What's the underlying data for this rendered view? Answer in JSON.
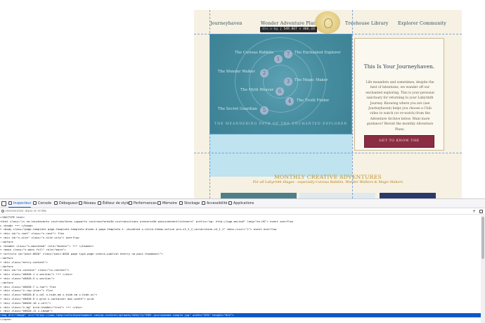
{
  "site": {
    "nav": [
      "Journeyhaven",
      "Wonder Adventure Plans",
      "Treehouse Library",
      "Explorer Community"
    ],
    "map_nodes": [
      {
        "num": "1",
        "label": "The Curious Rabbits"
      },
      {
        "num": "7",
        "label": "The Enchanted Explorer"
      },
      {
        "num": "2",
        "label": "The Wonder Walker"
      },
      {
        "num": "3",
        "label": "The Magic Maker"
      },
      {
        "num": "6",
        "label": "The Myth Weaver"
      },
      {
        "num": "4",
        "label": "The Truth Finder"
      },
      {
        "num": "5",
        "label": "The Secret Guardian"
      }
    ],
    "map_caption": "THE MEANDERING PATH OF THE ENCHANTED EXPLORER",
    "tooltip_name": "div.x-bg",
    "tooltip_size": "549.867 × 466.33",
    "journey": {
      "title": "This Is Your Journeyhaven.",
      "text": "Life meanders and sometimes, despite the best of intentions, we wander off our enchanted exploring. This is your personal sanctuary for returning to your Labyrinth Journey. Knowing where you are (see Journeyhaven) helps you choose a Club video to watch (or re-watch) from the Adventure Archive below. Want more guidance? Revisit the monthly Adventure Plans.",
      "button": "GET TO KNOW THE JOURNEYBOOK"
    },
    "monthly_title": "MONTHLY CREATIVE ADVENTURES",
    "monthly_sub": "For all Labyrinth Stages - especially Curious Rabbits, Wonder Walkers & Magic Makers"
  },
  "devtools": {
    "tabs": [
      "Inspecteur",
      "Console",
      "Débogueur",
      "Réseau",
      "Éditeur de style",
      "Performances",
      "Mémoire",
      "Stockage",
      "Accessibilité",
      "Applications"
    ],
    "active_tab": "Inspecteur",
    "search_placeholder": "Rechercher dans le HTML",
    "plus": "+",
    "lines": [
      {
        "text": "<!DOCTYPE html>",
        "selected": false
      },
      {
        "text": "<html class=\"js no-touchevents csstransforms supports csstransforms3d csstransitions preserve3d passiveeventlisteners\" prefix=\"og: http://ogp.me/ns#\" lang=\"en-US\"> event  overflow",
        "selected": false
      },
      {
        "text": "  ▸ <head> ••• </head>",
        "selected": false
      },
      {
        "text": "  ▾ <body class=\"page-template page-template-template-blank-4 page-template-t..disabled x-child-theme-active pro-v3_3_2_cornerstone-v4_1_2\" data-rsssl=\"1\"> event  overflow",
        "selected": false
      },
      {
        "text": "    ▾ <div id=\"x-root\" class=\"x-root\"> flex",
        "selected": false
      },
      {
        "text": "      ▾ <div id=\"x-site\" class=\"x-site site\"> overflow",
        "selected": false
      },
      {
        "text": "          ::before",
        "selected": false
      },
      {
        "text": "        ▸ <header class=\"x-masthead\" role=\"banner\"> ••• </header>",
        "selected": false
      },
      {
        "text": "        ▾ <main class=\"x-main full\" role=\"main\">",
        "selected": false
      },
      {
        "text": "          ▾ <article id=\"post-8620\" class=\"post-8620 page type-page status-publish hentry no-post-thumbnail\">",
        "selected": false
      },
      {
        "text": "              ::before",
        "selected": false
      },
      {
        "text": "            ▾ <div class=\"entry-content\">",
        "selected": false
      },
      {
        "text": "                ::before",
        "selected": false
      },
      {
        "text": "              ▾ <div id=\"cs-content\" class=\"cs-content\">",
        "selected": false
      },
      {
        "text": "                ▸ <div class=\"e8620-1 x-section\"> ••• </div>",
        "selected": false
      },
      {
        "text": "                ▾ <div class=\"e8620-5 x-section\">",
        "selected": false
      },
      {
        "text": "                    ::before",
        "selected": false
      },
      {
        "text": "                  ▾ <div class=\"e8620-7 x-row\"> flex",
        "selected": false
      },
      {
        "text": "                    ▾ <div class=\"x-row-inner\"> flex",
        "selected": false
      },
      {
        "text": "                      ▾ <div class=\"e8620-8 x-col x-hide-md x-hide-sm x-hide-xs\">",
        "selected": false
      },
      {
        "text": "                        ▾ <div class=\"e8620-9 x-grid x-container max width\"> grid",
        "selected": false
      },
      {
        "text": "                          ▾ <div class=\"e8620-10 x-cell\">",
        "selected": false
      },
      {
        "text": "                            ▸ <div class=\"x-bg\" aria-hidden=\"true\"> ••• </div>",
        "selected": false
      },
      {
        "text": "                            ▸ <div class=\"e8620-11 x-image\">",
        "selected": false
      },
      {
        "text": "                                <img alt=\"Image\" src=\"https://www.labyrinthsteynetmoment.com/wp-content/uploads/2020/12/TREE-journeybook-simple.jpg\" width=\"870\" height=\"612\">",
        "selected": true
      },
      {
        "text": "                              </span>",
        "selected": false
      }
    ]
  }
}
